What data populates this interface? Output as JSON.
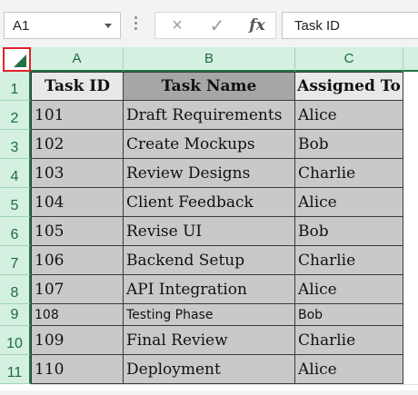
{
  "formula_bar": {
    "name_box": "A1",
    "cancel_icon": "×",
    "enter_icon": "✓",
    "fx_label": "fx",
    "formula_value": "Task ID"
  },
  "columns": [
    "A",
    "B",
    "C",
    ""
  ],
  "rows": [
    "1",
    "2",
    "3",
    "4",
    "5",
    "6",
    "7",
    "8",
    "9",
    "10",
    "11"
  ],
  "table": {
    "headers": [
      "Task ID",
      "Task Name",
      "Assigned To"
    ],
    "data": [
      [
        "101",
        "Draft Requirements",
        "Alice"
      ],
      [
        "102",
        "Create Mockups",
        "Bob"
      ],
      [
        "103",
        "Review Designs",
        "Charlie"
      ],
      [
        "104",
        "Client Feedback",
        "Alice"
      ],
      [
        "105",
        "Revise UI",
        "Bob"
      ],
      [
        "106",
        "Backend Setup",
        "Charlie"
      ],
      [
        "107",
        "API Integration",
        "Alice"
      ],
      [
        "108",
        "Testing Phase",
        "Bob"
      ],
      [
        "109",
        "Final Review",
        "Charlie"
      ],
      [
        "110",
        "Deployment",
        "Alice"
      ]
    ]
  },
  "colors": {
    "accent": "#217346",
    "header_bg": "#d3f0e0",
    "cell_bg": "#c9c9c9",
    "select_all_outline": "#e3222a"
  }
}
